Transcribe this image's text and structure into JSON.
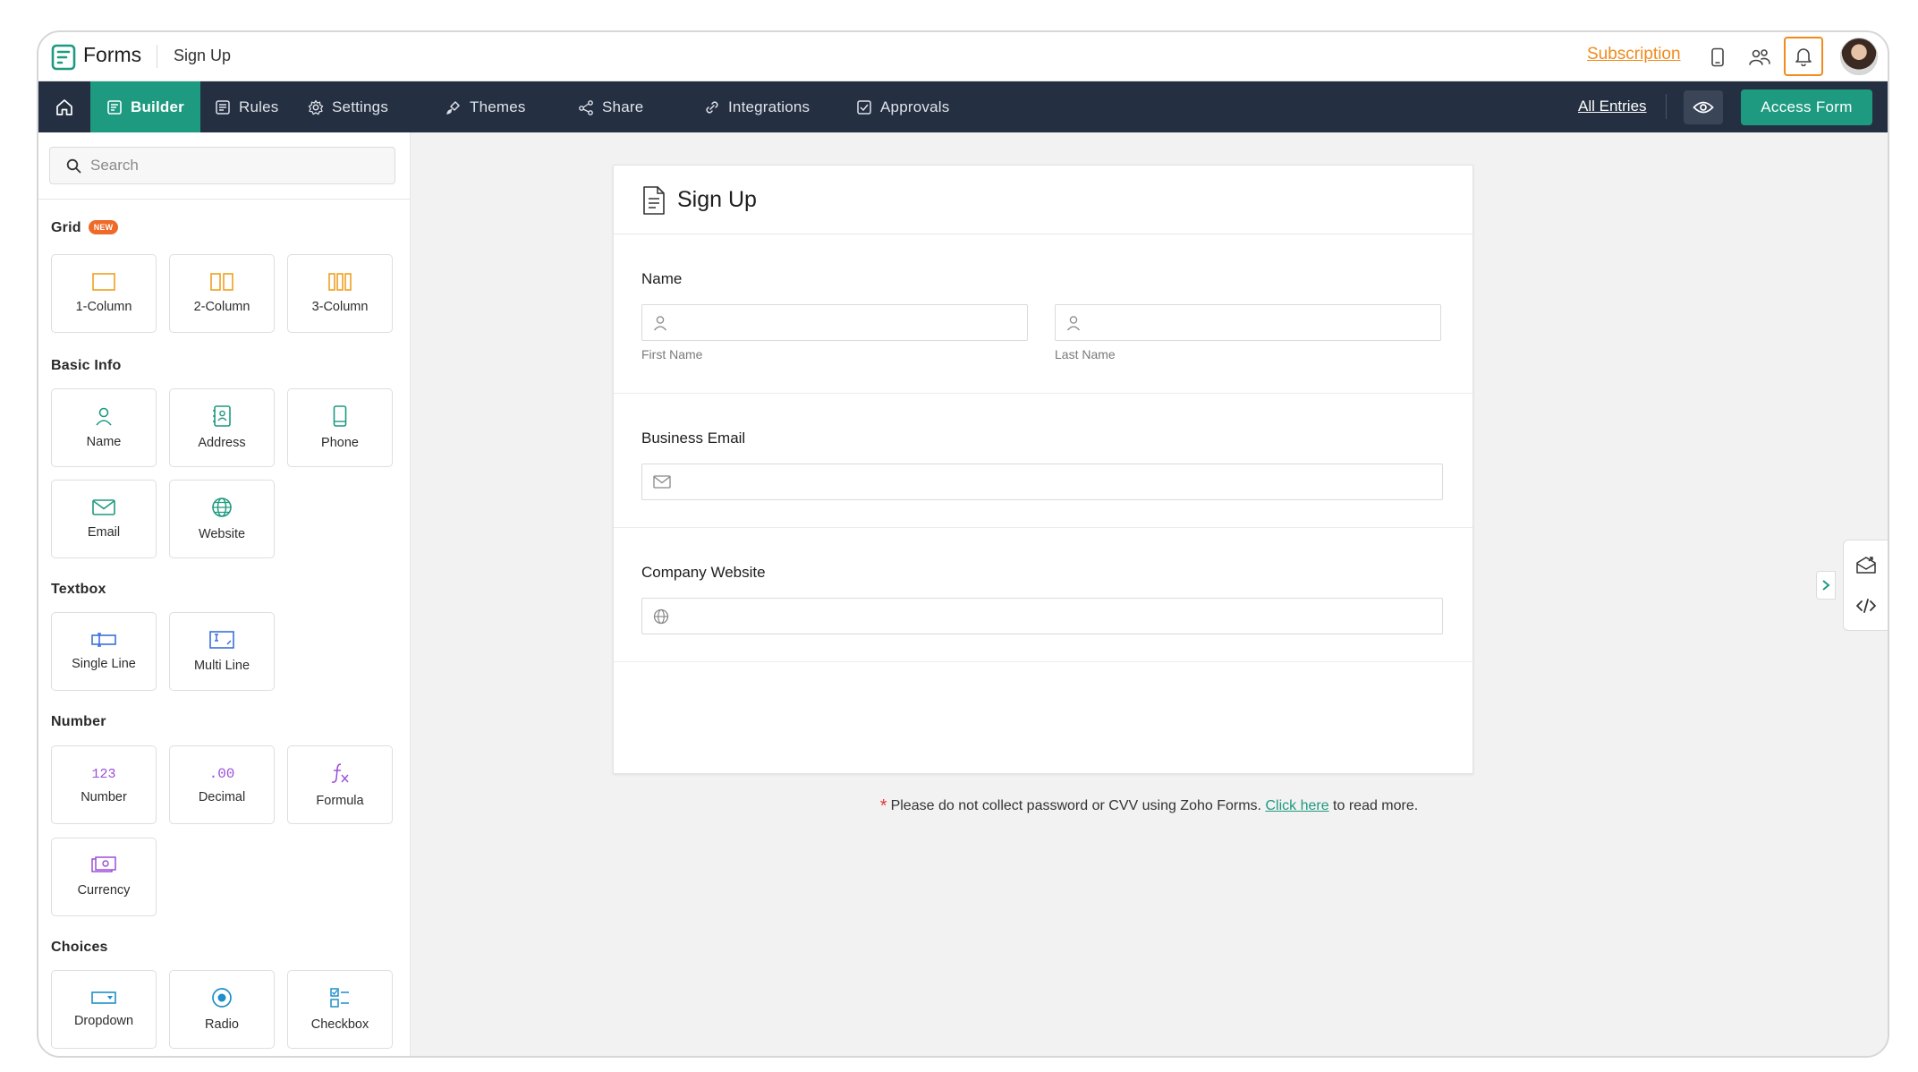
{
  "header": {
    "app_name": "Forms",
    "form_name": "Sign Up",
    "subscription_label": "Subscription"
  },
  "nav": {
    "tabs": [
      {
        "label": "Builder",
        "icon": "builder-icon",
        "active": true
      },
      {
        "label": "Rules",
        "icon": "rules-icon"
      },
      {
        "label": "Settings",
        "icon": "settings-icon"
      },
      {
        "label": "Themes",
        "icon": "themes-icon"
      },
      {
        "label": "Share",
        "icon": "share-icon"
      },
      {
        "label": "Integrations",
        "icon": "integrations-icon"
      },
      {
        "label": "Approvals",
        "icon": "approvals-icon"
      }
    ],
    "all_entries_label": "All Entries",
    "access_form_label": "Access Form"
  },
  "sidebar": {
    "search_placeholder": "Search",
    "sections": {
      "grid": {
        "title": "Grid",
        "badge": "NEW",
        "items": [
          "1-Column",
          "2-Column",
          "3-Column"
        ]
      },
      "basic_info": {
        "title": "Basic Info",
        "items": [
          "Name",
          "Address",
          "Phone",
          "Email",
          "Website"
        ]
      },
      "textbox": {
        "title": "Textbox",
        "items": [
          "Single Line",
          "Multi Line"
        ]
      },
      "number": {
        "title": "Number",
        "items": [
          "Number",
          "Decimal",
          "Formula",
          "Currency"
        ]
      },
      "choices": {
        "title": "Choices",
        "items": [
          "Dropdown",
          "Radio",
          "Checkbox"
        ]
      }
    }
  },
  "form": {
    "title": "Sign Up",
    "fields": {
      "name": {
        "label": "Name",
        "first_sub": "First Name",
        "last_sub": "Last Name"
      },
      "email": {
        "label": "Business Email"
      },
      "website": {
        "label": "Company Website"
      }
    },
    "note": {
      "star": "*",
      "text_before": "Please do not collect password or CVV using Zoho Forms.",
      "link": "Click here",
      "text_after": "to read more."
    }
  },
  "colors": {
    "accent_green": "#1e9a80",
    "nav_dark": "#242f41",
    "subscription_orange": "#f08b1d",
    "grid_icon_orange": "#f0a020",
    "basic_icon_green": "#1e9a80",
    "textbox_icon_blue": "#3a6fd8",
    "number_icon_purple": "#9a4fd8",
    "choices_icon_blue": "#1e8fc8"
  }
}
